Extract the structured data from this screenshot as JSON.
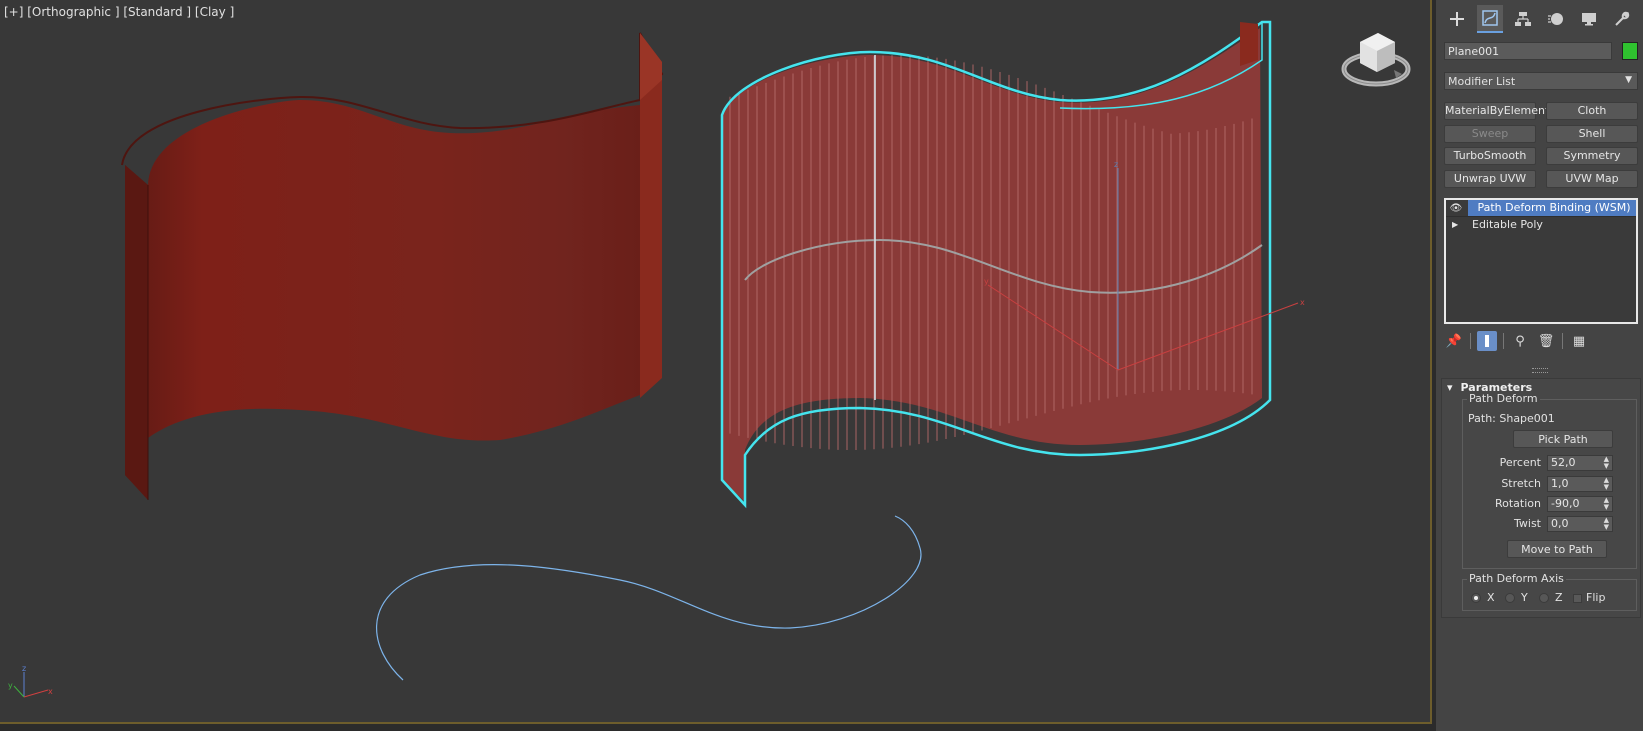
{
  "viewport": {
    "label": "[+] [Orthographic ] [Standard ] [Clay ]",
    "axis_labels": {
      "z": "z",
      "x": "x",
      "y": "y"
    }
  },
  "panel": {
    "tabs": [
      {
        "name": "create",
        "icon": "plus-icon"
      },
      {
        "name": "modify",
        "icon": "modify-icon",
        "active": true
      },
      {
        "name": "hierarchy",
        "icon": "hierarchy-icon"
      },
      {
        "name": "motion",
        "icon": "motion-icon"
      },
      {
        "name": "display",
        "icon": "display-icon"
      },
      {
        "name": "utilities",
        "icon": "wrench-icon"
      }
    ],
    "object_name": "Plane001",
    "object_color": "#2fc22f",
    "modifier_list": "Modifier List",
    "modifier_buttons": [
      {
        "label": "MaterialByElement",
        "enabled": true
      },
      {
        "label": "Cloth",
        "enabled": true
      },
      {
        "label": "Sweep",
        "enabled": false
      },
      {
        "label": "Shell",
        "enabled": true
      },
      {
        "label": "TurboSmooth",
        "enabled": true
      },
      {
        "label": "Symmetry",
        "enabled": true
      },
      {
        "label": "Unwrap UVW",
        "enabled": true
      },
      {
        "label": "UVW Map",
        "enabled": true
      }
    ],
    "stack": [
      {
        "label": "Path Deform Binding (WSM)",
        "selected": true
      },
      {
        "label": "Editable Poly",
        "selected": false
      }
    ]
  },
  "parameters": {
    "title": "Parameters",
    "group_title": "Path Deform",
    "path_text": "Path: Shape001",
    "pick_path": "Pick Path",
    "percent_label": "Percent",
    "percent_value": "52,0",
    "stretch_label": "Stretch",
    "stretch_value": "1,0",
    "rotation_label": "Rotation",
    "rotation_value": "-90,0",
    "twist_label": "Twist",
    "twist_value": "0,0",
    "move_to_path": "Move to Path",
    "axis_group_title": "Path Deform Axis",
    "axis_x": "X",
    "axis_y": "Y",
    "axis_z": "Z",
    "flip": "Flip",
    "selected_axis": "X"
  }
}
